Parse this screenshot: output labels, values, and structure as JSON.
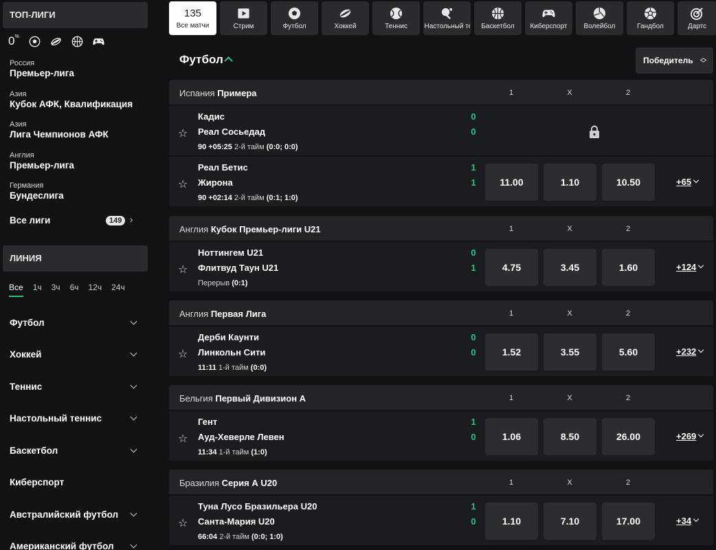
{
  "sidebar": {
    "top_header": "ТОП-ЛИГИ",
    "zero_label": "0",
    "zero_suffix": "%",
    "sport_icons": [
      "football-icon",
      "hockey-icon",
      "basketball-icon",
      "esports-icon"
    ],
    "leagues": [
      {
        "region": "Россия",
        "name": "Премьер-лига"
      },
      {
        "region": "Азия",
        "name": "Кубок АФК, Квалификация"
      },
      {
        "region": "Азия",
        "name": "Лига Чемпионов АФК"
      },
      {
        "region": "Англия",
        "name": "Премьер-лига"
      },
      {
        "region": "Германия",
        "name": "Бундеслига"
      }
    ],
    "all_leagues": "Все лиги",
    "all_count": "149",
    "line_header": "ЛИНИЯ",
    "time_tabs": [
      "Все",
      "1ч",
      "3ч",
      "6ч",
      "12ч",
      "24ч"
    ],
    "sports": [
      {
        "label": "Футбол",
        "has_chevron": true
      },
      {
        "label": "Хоккей",
        "has_chevron": true
      },
      {
        "label": "Теннис",
        "has_chevron": true
      },
      {
        "label": "Настольный теннис",
        "has_chevron": true
      },
      {
        "label": "Баскетбол",
        "has_chevron": true
      },
      {
        "label": "Киберспорт",
        "has_chevron": false
      },
      {
        "label": "Австралийский футбол",
        "has_chevron": true
      },
      {
        "label": "Американский футбол",
        "has_chevron": true
      }
    ]
  },
  "tabs": [
    {
      "label": "Все матчи",
      "count": "135",
      "icon": "count"
    },
    {
      "label": "Стрим",
      "icon": "play-icon"
    },
    {
      "label": "Футбол",
      "icon": "football-icon"
    },
    {
      "label": "Хоккей",
      "icon": "hockey-icon"
    },
    {
      "label": "Теннис",
      "icon": "tennis-icon"
    },
    {
      "label": "Настольный теннис",
      "icon": "table-tennis-icon"
    },
    {
      "label": "Баскетбол",
      "icon": "basketball-icon"
    },
    {
      "label": "Киберспорт",
      "icon": "esports-icon"
    },
    {
      "label": "Волейбол",
      "icon": "volleyball-icon"
    },
    {
      "label": "Гандбол",
      "icon": "handball-icon"
    },
    {
      "label": "Дартс",
      "icon": "darts-icon"
    }
  ],
  "main": {
    "title": "Футбол",
    "market_select": "Победитель",
    "col_labels": [
      "1",
      "X",
      "2"
    ],
    "league_blocks": [
      {
        "region": "Испания",
        "name": "Примера",
        "matches": [
          {
            "team1": "Кадис",
            "team2": "Реал Сосьедад",
            "score1": "0",
            "score2": "0",
            "time": "90 +05:25",
            "period": "2-й тайм",
            "sub": "(0:0; 0:0)",
            "locked": true,
            "odds": [],
            "more": ""
          },
          {
            "team1": "Реал Бетис",
            "team2": "Жирона",
            "score1": "1",
            "score2": "1",
            "time": "90 +02:14",
            "period": "2-й тайм",
            "sub": "(0:1; 1:0)",
            "locked": false,
            "odds": [
              "11.00",
              "1.10",
              "10.50"
            ],
            "more": "+65"
          }
        ]
      },
      {
        "region": "Англия",
        "name": "Кубок Премьер-лиги U21",
        "matches": [
          {
            "team1": "Ноттингем U21",
            "team2": "Флитвуд Таун U21",
            "score1": "0",
            "score2": "1",
            "time": "",
            "period": "Перерыв",
            "sub": "(0:1)",
            "locked": false,
            "odds": [
              "4.75",
              "3.45",
              "1.60"
            ],
            "more": "+124"
          }
        ]
      },
      {
        "region": "Англия",
        "name": "Первая Лига",
        "matches": [
          {
            "team1": "Дерби Каунти",
            "team2": "Линкольн Сити",
            "score1": "0",
            "score2": "0",
            "time": "11:11",
            "period": "1-й тайм",
            "sub": "(0:0)",
            "locked": false,
            "odds": [
              "1.52",
              "3.55",
              "5.60"
            ],
            "more": "+232"
          }
        ]
      },
      {
        "region": "Бельгия",
        "name": "Первый Дивизион А",
        "matches": [
          {
            "team1": "Гент",
            "team2": "Ауд-Хеверле Левен",
            "score1": "1",
            "score2": "0",
            "time": "11:34",
            "period": "1-й тайм",
            "sub": "(1:0)",
            "locked": false,
            "odds": [
              "1.06",
              "8.50",
              "26.00"
            ],
            "more": "+269"
          }
        ]
      },
      {
        "region": "Бразилия",
        "name": "Серия А U20",
        "matches": [
          {
            "team1": "Туна Лусо Бразильера U20",
            "team2": "Санта-Мария U20",
            "score1": "1",
            "score2": "0",
            "time": "66:04",
            "period": "2-й тайм",
            "sub": "(0:0; 1:0)",
            "locked": false,
            "odds": [
              "1.10",
              "7.10",
              "17.00"
            ],
            "more": "+34"
          }
        ]
      }
    ]
  }
}
